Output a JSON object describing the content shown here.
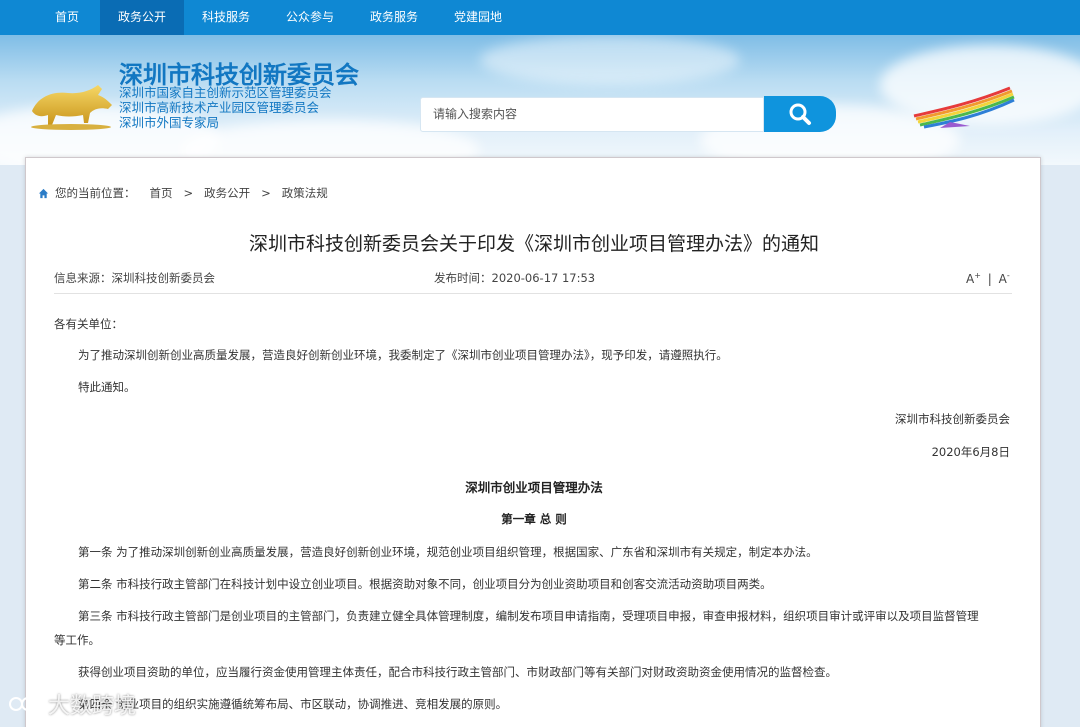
{
  "nav": [
    "首页",
    "政务公开",
    "科技服务",
    "公众参与",
    "政务服务",
    "党建园地"
  ],
  "header": {
    "title": "深圳市科技创新委员会",
    "subs": [
      "深圳市国家自主创新示范区管理委员会",
      "深圳市高新技术产业园区管理委员会",
      "深圳市外国专家局"
    ],
    "search_placeholder": "请输入搜索内容"
  },
  "breadcrumb": {
    "label": "您的当前位置：",
    "items": [
      "首页",
      "政务公开",
      "政策法规"
    ],
    "sep": ">"
  },
  "article": {
    "title": "深圳市科技创新委员会关于印发《深圳市创业项目管理办法》的通知",
    "source": "信息来源：深圳科技创新委员会",
    "date": "发布时间：2020-06-17 17:53",
    "font_up": "A",
    "font_down": "A",
    "font_sep": "|",
    "salutation": "各有关单位：",
    "para1": "为了推动深圳创新创业高质量发展，营造良好创新创业环境，我委制定了《深圳市创业项目管理办法》，现予印发，请遵照执行。",
    "notice": "特此通知。",
    "signature": "深圳市科技创新委员会",
    "sign_date": "2020年6月8日",
    "doc_title": "深圳市创业项目管理办法",
    "chapter": "第一章 总 则",
    "art1": "第一条 为了推动深圳创新创业高质量发展，营造良好创新创业环境，规范创业项目组织管理，根据国家、广东省和深圳市有关规定，制定本办法。",
    "art2": "第二条 市科技行政主管部门在科技计划中设立创业项目。根据资助对象不同，创业项目分为创业资助项目和创客交流活动资助项目两类。",
    "art3a": "第三条 市科技行政主管部门是创业项目的主管部门，负责建立健全具体管理制度，编制发布项目申请指南，受理项目申报，审查申报材料，组织项目审计或评审以及项目监督管理",
    "art3b": "等工作。",
    "art3c": "获得创业项目资助的单位，应当履行资金使用管理主体责任，配合市科技行政主管部门、市财政部门等有关部门对财政资助资金使用情况的监督检查。",
    "art4": "第四条 创业项目的组织实施遵循统筹布局、市区联动，协调推进、竞相发展的原则。"
  },
  "watermark": "大数跨境"
}
